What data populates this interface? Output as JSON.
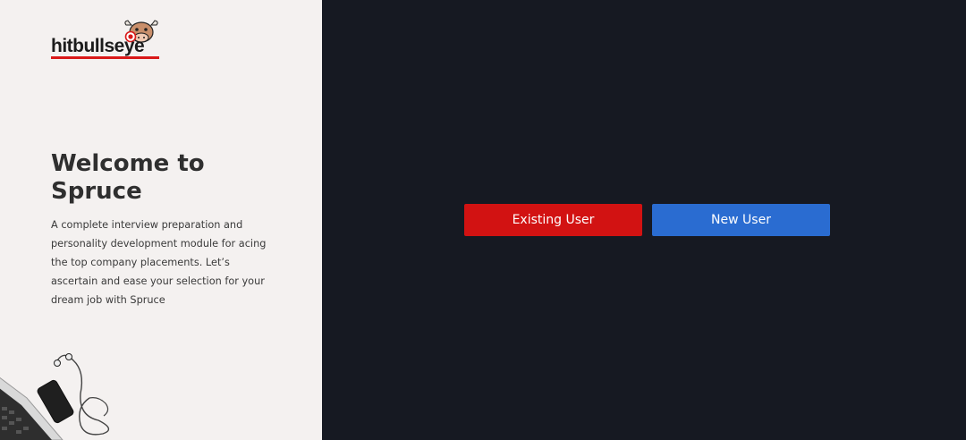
{
  "brand": {
    "logo_text": "hitbullseye",
    "accent_color": "#d91919"
  },
  "intro": {
    "title": "Welcome to Spruce",
    "description": "A complete interview preparation and personality development module for acing the top company placements. Let’s ascertain and ease your selection for your dream job with Spruce"
  },
  "actions": {
    "existing_user_label": "Existing User",
    "new_user_label": "New User",
    "existing_color": "#d21212",
    "new_color": "#2a6cd1"
  },
  "icons": {
    "logo_mascot": "bull-icon",
    "desk_illustration": "laptop-phone-earphones-image"
  }
}
